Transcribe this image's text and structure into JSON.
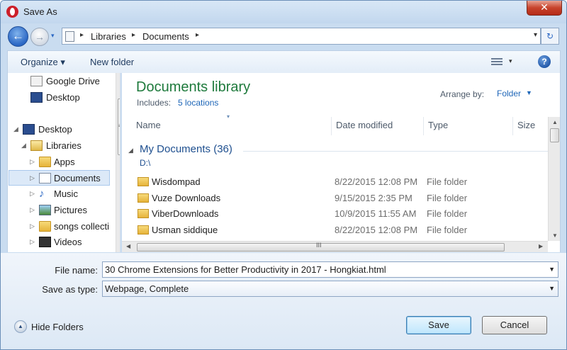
{
  "window": {
    "title": "Save As",
    "close_glyph": "✕"
  },
  "navigation": {
    "back_glyph": "←",
    "forward_glyph": "→",
    "recent_glyph": "▾",
    "breadcrumb": [
      "Libraries",
      "Documents"
    ],
    "separator": "▸",
    "dropdown_glyph": "▾",
    "refresh_glyph": "↻"
  },
  "toolbar": {
    "organize_label": "Organize ▾",
    "new_folder_label": "New folder",
    "views_caret": "▾",
    "help_glyph": "?"
  },
  "sidebar": {
    "items": [
      {
        "label": "Google Drive",
        "icon": "google-drive-icon",
        "arrow": ""
      },
      {
        "label": "Desktop",
        "icon": "desktop-icon",
        "arrow": ""
      },
      {
        "label": "Desktop",
        "icon": "desktop-icon",
        "arrow": "◢"
      },
      {
        "label": "Libraries",
        "icon": "library-icon",
        "arrow": "◢"
      },
      {
        "label": "Apps",
        "icon": "folder-icon",
        "arrow": "▷"
      },
      {
        "label": "Documents",
        "icon": "documents-icon",
        "arrow": "▷",
        "selected": true
      },
      {
        "label": "Music",
        "icon": "music-icon",
        "arrow": "▷"
      },
      {
        "label": "Pictures",
        "icon": "pictures-icon",
        "arrow": "▷"
      },
      {
        "label": "songs collecti",
        "icon": "folder-icon",
        "arrow": "▷"
      },
      {
        "label": "Videos",
        "icon": "videos-icon",
        "arrow": "▷"
      }
    ],
    "scroll_grip": "≡",
    "scroll_down": "▼"
  },
  "library": {
    "title": "Documents library",
    "includes_label": "Includes:",
    "includes_link": "5 locations",
    "arrange_label": "Arrange by:",
    "arrange_value": "Folder",
    "arrange_caret": "▼",
    "sort_caret": "▾"
  },
  "columns": [
    "Name",
    "Date modified",
    "Type",
    "Size"
  ],
  "group": {
    "name": "My Documents (36)",
    "path": "D:\\",
    "arrow": "◢"
  },
  "rows": [
    {
      "name": "Wisdompad",
      "date": "8/22/2015 12:08 PM",
      "type": "File folder"
    },
    {
      "name": "Vuze Downloads",
      "date": "9/15/2015 2:35 PM",
      "type": "File folder"
    },
    {
      "name": "ViberDownloads",
      "date": "10/9/2015 11:55 AM",
      "type": "File folder"
    },
    {
      "name": "Usman siddique",
      "date": "8/22/2015 12:08 PM",
      "type": "File folder"
    }
  ],
  "scroll": {
    "up": "▲",
    "down": "▼",
    "left": "◀",
    "right": "▶",
    "grip": "III"
  },
  "form": {
    "file_name_label": "File name:",
    "file_name_value": "30 Chrome Extensions for Better Productivity in 2017 - Hongkiat.html",
    "save_type_label": "Save as type:",
    "save_type_value": "Webpage, Complete",
    "caret": "▼"
  },
  "footer": {
    "hide_folders_glyph": "▲",
    "hide_folders_label": "Hide Folders",
    "save_label": "Save",
    "cancel_label": "Cancel"
  }
}
